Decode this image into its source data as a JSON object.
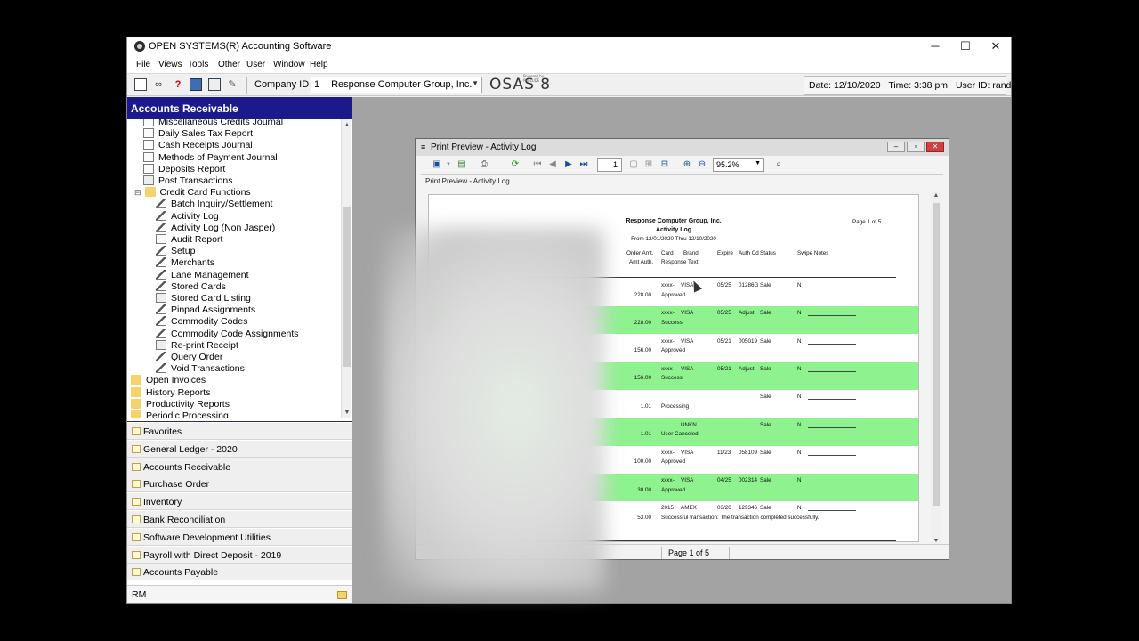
{
  "window": {
    "title": "OPEN SYSTEMS(R) Accounting Software",
    "minimize": "─",
    "maximize": "☐",
    "close": "✕"
  },
  "menu": [
    "File",
    "Views",
    "Tools",
    "Other",
    "User",
    "Window",
    "Help"
  ],
  "toolbar": {
    "icons": [
      "window-icon",
      "glasses-icon",
      "help-icon",
      "calculator-icon",
      "calendar-icon",
      "notes-icon"
    ],
    "company_label": "Company ID",
    "company_num": "1",
    "company_name": "Response Computer Group, Inc.",
    "logo": "OSAS 8",
    "logo_sub": "Powered by PRELUDE",
    "date": "Date: 12/10/2020",
    "time": "Time: 3:38 pm",
    "user": "User ID: randy"
  },
  "left_panel": {
    "header": "Accounts Receivable",
    "tree": [
      {
        "label": "Miscellaneous Credits Journal",
        "icon": "report",
        "indent": 1
      },
      {
        "label": "Daily Sales Tax Report",
        "icon": "report",
        "indent": 1
      },
      {
        "label": "Cash Receipts Journal",
        "icon": "report",
        "indent": 1
      },
      {
        "label": "Methods of Payment Journal",
        "icon": "report",
        "indent": 1
      },
      {
        "label": "Deposits Report",
        "icon": "report",
        "indent": 1
      },
      {
        "label": "Post Transactions",
        "icon": "post",
        "indent": 1
      },
      {
        "label": "Credit Card Functions",
        "icon": "folder",
        "indent": 0
      },
      {
        "label": "Batch Inquiry/Settlement",
        "icon": "pencil",
        "indent": 2
      },
      {
        "label": "Activity Log",
        "icon": "pencil",
        "indent": 2
      },
      {
        "label": "Activity Log (Non Jasper)",
        "icon": "pencil",
        "indent": 2
      },
      {
        "label": "Audit Report",
        "icon": "report",
        "indent": 2
      },
      {
        "label": "Setup",
        "icon": "pencil",
        "indent": 2
      },
      {
        "label": "Merchants",
        "icon": "pencil",
        "indent": 2
      },
      {
        "label": "Lane Management",
        "icon": "pencil",
        "indent": 2
      },
      {
        "label": "Stored Cards",
        "icon": "pencil",
        "indent": 2
      },
      {
        "label": "Stored Card Listing",
        "icon": "doc",
        "indent": 2
      },
      {
        "label": "Pinpad Assignments",
        "icon": "pencil",
        "indent": 2
      },
      {
        "label": "Commodity Codes",
        "icon": "pencil",
        "indent": 2
      },
      {
        "label": "Commodity Code Assignments",
        "icon": "pencil",
        "indent": 2
      },
      {
        "label": "Re-print Receipt",
        "icon": "printer",
        "indent": 2
      },
      {
        "label": "Query Order",
        "icon": "pencil",
        "indent": 2
      },
      {
        "label": "Void Transactions",
        "icon": "pencil",
        "indent": 2
      },
      {
        "label": "Open Invoices",
        "icon": "folder",
        "indent": -1
      },
      {
        "label": "History Reports",
        "icon": "folder",
        "indent": -1
      },
      {
        "label": "Productivity Reports",
        "icon": "folder",
        "indent": -1
      },
      {
        "label": "Periodic Processing",
        "icon": "folder",
        "indent": -1
      }
    ],
    "modules": [
      "Favorites",
      "General Ledger - 2020",
      "Accounts Receivable",
      "Purchase Order",
      "Inventory",
      "Bank Reconciliation",
      "Software Development Utilities",
      "Payroll with Direct Deposit - 2019",
      "Accounts Payable"
    ],
    "footer": "RM"
  },
  "preview": {
    "title": "Print Preview - Activity Log",
    "tab": "Print Preview - Activity Log",
    "page_input": "1",
    "zoom": "95.2%",
    "status": "Page 1 of 5"
  },
  "report": {
    "company": "Response Computer Group, Inc.",
    "title": "Activity Log",
    "range": "From 12/01/2020 Thru 12/10/2020",
    "page": "Page 1 of 5",
    "headers": {
      "order_amt": "Order Amt.",
      "amt_auth": "Amt Auth.",
      "card": "Card",
      "brand": "Brand",
      "response": "Response Text",
      "expire": "Expire",
      "auth_cd": "Auth Cd",
      "status": "Status",
      "swipe": "Swipe Notes"
    },
    "rows": [
      {
        "card": "xxxx-",
        "brand": "VISA",
        "expire": "05/25",
        "auth": "01286G",
        "status": "Sale",
        "swipe": "N",
        "amt": "228.00",
        "response": "Approved",
        "highlight": false
      },
      {
        "card": "xxxx-",
        "brand": "VISA",
        "expire": "05/25",
        "auth": "Adjust",
        "status": "Sale",
        "swipe": "N",
        "amt": "228.00",
        "response": "Success",
        "highlight": true
      },
      {
        "card": "xxxx-",
        "brand": "VISA",
        "expire": "05/21",
        "auth": "005019",
        "status": "Sale",
        "swipe": "N",
        "amt": "156.00",
        "response": "Approved",
        "highlight": false
      },
      {
        "card": "xxxx-",
        "brand": "VISA",
        "expire": "05/21",
        "auth": "Adjust",
        "status": "Sale",
        "swipe": "N",
        "amt": "156.00",
        "response": "Success",
        "highlight": true
      },
      {
        "card": "",
        "brand": "",
        "expire": "",
        "auth": "",
        "status": "Sale",
        "swipe": "N",
        "amt": "1.01",
        "response": "Processing",
        "highlight": false
      },
      {
        "card": "",
        "brand": "UNKN",
        "expire": "",
        "auth": "",
        "status": "Sale",
        "swipe": "N",
        "amt": "1.01",
        "response": "User Canceled",
        "highlight": true
      },
      {
        "card": "xxxx-",
        "brand": "VISA",
        "expire": "11/23",
        "auth": "058109",
        "status": "Sale",
        "swipe": "N",
        "amt": "100.00",
        "response": "Approved",
        "highlight": false
      },
      {
        "card": "xxxx-",
        "brand": "VISA",
        "expire": "04/25",
        "auth": "002314",
        "status": "Sale",
        "swipe": "N",
        "amt": "30.00",
        "response": "Approved",
        "highlight": true
      },
      {
        "card": "2015",
        "brand": "AMEX",
        "expire": "03/20",
        "auth": "129346",
        "status": "Sale",
        "swipe": "N",
        "amt": "53.00",
        "response": "Successful transaction: The transaction completed successfully.",
        "highlight": false
      }
    ]
  }
}
